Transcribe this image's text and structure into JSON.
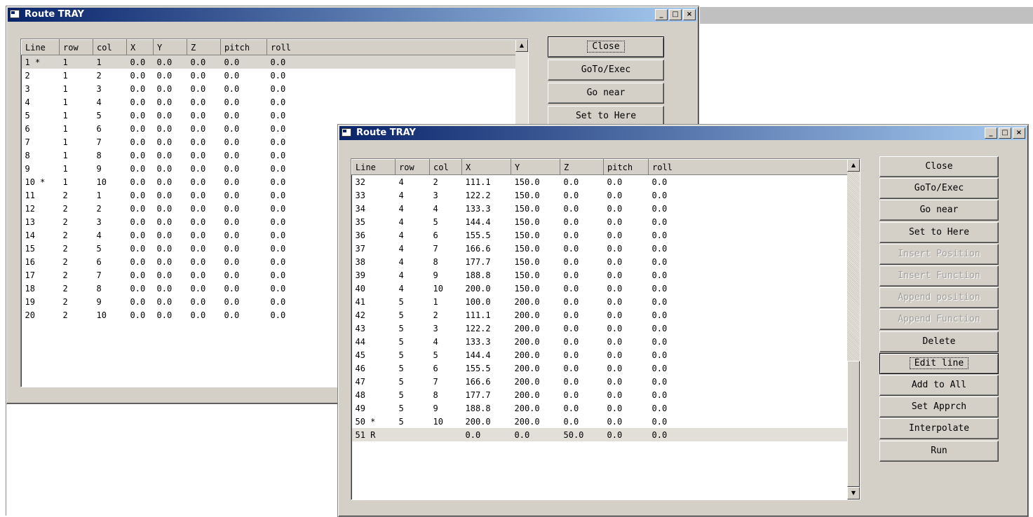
{
  "window_back": {
    "title": "Route TRAY",
    "columns": [
      "Line",
      "row",
      "col",
      "X",
      "Y",
      "Z",
      "pitch",
      "roll"
    ],
    "rows": [
      [
        "1 *",
        "1",
        "1",
        "0.0",
        "0.0",
        "0.0",
        "0.0",
        "0.0"
      ],
      [
        "2",
        "1",
        "2",
        "0.0",
        "0.0",
        "0.0",
        "0.0",
        "0.0"
      ],
      [
        "3",
        "1",
        "3",
        "0.0",
        "0.0",
        "0.0",
        "0.0",
        "0.0"
      ],
      [
        "4",
        "1",
        "4",
        "0.0",
        "0.0",
        "0.0",
        "0.0",
        "0.0"
      ],
      [
        "5",
        "1",
        "5",
        "0.0",
        "0.0",
        "0.0",
        "0.0",
        "0.0"
      ],
      [
        "6",
        "1",
        "6",
        "0.0",
        "0.0",
        "0.0",
        "0.0",
        "0.0"
      ],
      [
        "7",
        "1",
        "7",
        "0.0",
        "0.0",
        "0.0",
        "0.0",
        "0.0"
      ],
      [
        "8",
        "1",
        "8",
        "0.0",
        "0.0",
        "0.0",
        "0.0",
        "0.0"
      ],
      [
        "9",
        "1",
        "9",
        "0.0",
        "0.0",
        "0.0",
        "0.0",
        "0.0"
      ],
      [
        "10 *",
        "1",
        "10",
        "0.0",
        "0.0",
        "0.0",
        "0.0",
        "0.0"
      ],
      [
        "11",
        "2",
        "1",
        "0.0",
        "0.0",
        "0.0",
        "0.0",
        "0.0"
      ],
      [
        "12",
        "2",
        "2",
        "0.0",
        "0.0",
        "0.0",
        "0.0",
        "0.0"
      ],
      [
        "13",
        "2",
        "3",
        "0.0",
        "0.0",
        "0.0",
        "0.0",
        "0.0"
      ],
      [
        "14",
        "2",
        "4",
        "0.0",
        "0.0",
        "0.0",
        "0.0",
        "0.0"
      ],
      [
        "15",
        "2",
        "5",
        "0.0",
        "0.0",
        "0.0",
        "0.0",
        "0.0"
      ],
      [
        "16",
        "2",
        "6",
        "0.0",
        "0.0",
        "0.0",
        "0.0",
        "0.0"
      ],
      [
        "17",
        "2",
        "7",
        "0.0",
        "0.0",
        "0.0",
        "0.0",
        "0.0"
      ],
      [
        "18",
        "2",
        "8",
        "0.0",
        "0.0",
        "0.0",
        "0.0",
        "0.0"
      ],
      [
        "19",
        "2",
        "9",
        "0.0",
        "0.0",
        "0.0",
        "0.0",
        "0.0"
      ],
      [
        "20",
        "2",
        "10",
        "0.0",
        "0.0",
        "0.0",
        "0.0",
        "0.0"
      ]
    ],
    "buttons": [
      {
        "label": "Close",
        "state": "focused"
      },
      {
        "label": "GoTo/Exec",
        "state": "normal"
      },
      {
        "label": "Go near",
        "state": "normal"
      },
      {
        "label": "Set to Here",
        "state": "normal"
      }
    ]
  },
  "window_front": {
    "title": "Route TRAY",
    "columns": [
      "Line",
      "row",
      "col",
      "X",
      "Y",
      "Z",
      "pitch",
      "roll"
    ],
    "rows": [
      [
        "32",
        "4",
        "2",
        "111.1",
        "150.0",
        "0.0",
        "0.0",
        "0.0"
      ],
      [
        "33",
        "4",
        "3",
        "122.2",
        "150.0",
        "0.0",
        "0.0",
        "0.0"
      ],
      [
        "34",
        "4",
        "4",
        "133.3",
        "150.0",
        "0.0",
        "0.0",
        "0.0"
      ],
      [
        "35",
        "4",
        "5",
        "144.4",
        "150.0",
        "0.0",
        "0.0",
        "0.0"
      ],
      [
        "36",
        "4",
        "6",
        "155.5",
        "150.0",
        "0.0",
        "0.0",
        "0.0"
      ],
      [
        "37",
        "4",
        "7",
        "166.6",
        "150.0",
        "0.0",
        "0.0",
        "0.0"
      ],
      [
        "38",
        "4",
        "8",
        "177.7",
        "150.0",
        "0.0",
        "0.0",
        "0.0"
      ],
      [
        "39",
        "4",
        "9",
        "188.8",
        "150.0",
        "0.0",
        "0.0",
        "0.0"
      ],
      [
        "40",
        "4",
        "10",
        "200.0",
        "150.0",
        "0.0",
        "0.0",
        "0.0"
      ],
      [
        "41",
        "5",
        "1",
        "100.0",
        "200.0",
        "0.0",
        "0.0",
        "0.0"
      ],
      [
        "42",
        "5",
        "2",
        "111.1",
        "200.0",
        "0.0",
        "0.0",
        "0.0"
      ],
      [
        "43",
        "5",
        "3",
        "122.2",
        "200.0",
        "0.0",
        "0.0",
        "0.0"
      ],
      [
        "44",
        "5",
        "4",
        "133.3",
        "200.0",
        "0.0",
        "0.0",
        "0.0"
      ],
      [
        "45",
        "5",
        "5",
        "144.4",
        "200.0",
        "0.0",
        "0.0",
        "0.0"
      ],
      [
        "46",
        "5",
        "6",
        "155.5",
        "200.0",
        "0.0",
        "0.0",
        "0.0"
      ],
      [
        "47",
        "5",
        "7",
        "166.6",
        "200.0",
        "0.0",
        "0.0",
        "0.0"
      ],
      [
        "48",
        "5",
        "8",
        "177.7",
        "200.0",
        "0.0",
        "0.0",
        "0.0"
      ],
      [
        "49",
        "5",
        "9",
        "188.8",
        "200.0",
        "0.0",
        "0.0",
        "0.0"
      ],
      [
        "50 *",
        "5",
        "10",
        "200.0",
        "200.0",
        "0.0",
        "0.0",
        "0.0"
      ],
      [
        "51 R",
        "",
        "",
        "0.0",
        "0.0",
        "50.0",
        "0.0",
        "0.0"
      ]
    ],
    "buttons": [
      {
        "label": "Close",
        "state": "normal"
      },
      {
        "label": "GoTo/Exec",
        "state": "normal"
      },
      {
        "label": "Go near",
        "state": "normal"
      },
      {
        "label": "Set to Here",
        "state": "normal"
      },
      {
        "label": "Insert Position",
        "state": "disabled"
      },
      {
        "label": "Insert Function",
        "state": "disabled"
      },
      {
        "label": "Append position",
        "state": "disabled"
      },
      {
        "label": "Append Function",
        "state": "disabled"
      },
      {
        "label": "Delete",
        "state": "normal"
      },
      {
        "label": "Edit line",
        "state": "focused"
      },
      {
        "label": "Add to All",
        "state": "normal"
      },
      {
        "label": "Set Apprch",
        "state": "normal"
      },
      {
        "label": "Interpolate",
        "state": "normal"
      },
      {
        "label": "Run",
        "state": "normal"
      }
    ]
  },
  "titlebar_glyphs": {
    "minimize": "_",
    "maximize": "□",
    "close": "×"
  },
  "scroll_glyphs": {
    "up": "▲",
    "down": "▼"
  },
  "icons": {
    "window": "app-window-icon"
  },
  "colors": {
    "title_active_start": "#0a246a",
    "title_active_end": "#a6caf0",
    "face": "#d4d0c8"
  }
}
